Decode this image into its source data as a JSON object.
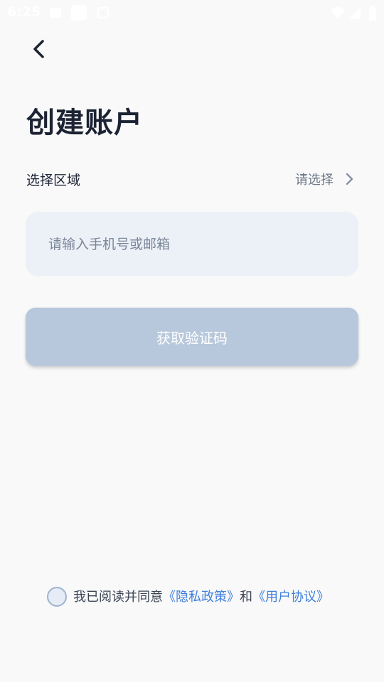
{
  "status_bar": {
    "time": "6:25"
  },
  "header": {
    "title": "创建账户"
  },
  "region": {
    "label": "选择区域",
    "value": "请选择"
  },
  "phone_input": {
    "value": "",
    "placeholder": "请输入手机号或邮箱"
  },
  "get_code_button": {
    "label": "获取验证码"
  },
  "agreement": {
    "prefix": "我已阅读并同意",
    "privacy_link": "《隐私政策》",
    "conjunction": "和",
    "terms_link": "《用户协议》",
    "checked": false
  },
  "colors": {
    "background": "#f9f9fa",
    "input_bg": "#ecf1f8",
    "button_disabled": "#b8c8dc",
    "link": "#3f7fdb"
  },
  "icons": [
    "wifi-icon",
    "signal-icon",
    "battery-icon",
    "back-arrow-icon",
    "chevron-right-icon"
  ]
}
